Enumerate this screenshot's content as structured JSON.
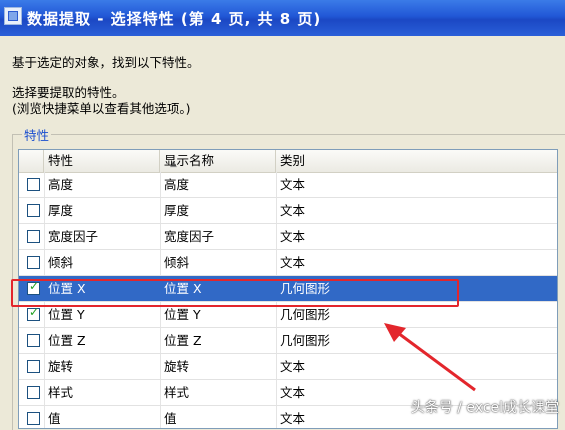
{
  "window": {
    "title": "数据提取 - 选择特性 (第 4 页, 共 8 页)"
  },
  "description": {
    "line1": "基于选定的对象，找到以下特性。",
    "line2": "选择要提取的特性。",
    "line3": "(浏览快捷菜单以查看其他选项。)"
  },
  "group": {
    "label": "特性"
  },
  "table": {
    "headers": [
      "特性",
      "显示名称",
      "类别"
    ],
    "rows": [
      {
        "property": "高度",
        "display": "高度",
        "category": "文本",
        "checked": false
      },
      {
        "property": "厚度",
        "display": "厚度",
        "category": "文本",
        "checked": false
      },
      {
        "property": "宽度因子",
        "display": "宽度因子",
        "category": "文本",
        "checked": false
      },
      {
        "property": "倾斜",
        "display": "倾斜",
        "category": "文本",
        "checked": false
      },
      {
        "property": "位置 X",
        "display": "位置 X",
        "category": "几何图形",
        "checked": true
      },
      {
        "property": "位置 Y",
        "display": "位置 Y",
        "category": "几何图形",
        "checked": true
      },
      {
        "property": "位置 Z",
        "display": "位置 Z",
        "category": "几何图形",
        "checked": false
      },
      {
        "property": "旋转",
        "display": "旋转",
        "category": "文本",
        "checked": false
      },
      {
        "property": "样式",
        "display": "样式",
        "category": "文本",
        "checked": false
      },
      {
        "property": "值",
        "display": "值",
        "category": "文本",
        "checked": false
      }
    ]
  },
  "watermark": "头条号 / excel成长课堂",
  "colors": {
    "selection": "#3169c6",
    "annotation": "#e3262c"
  }
}
